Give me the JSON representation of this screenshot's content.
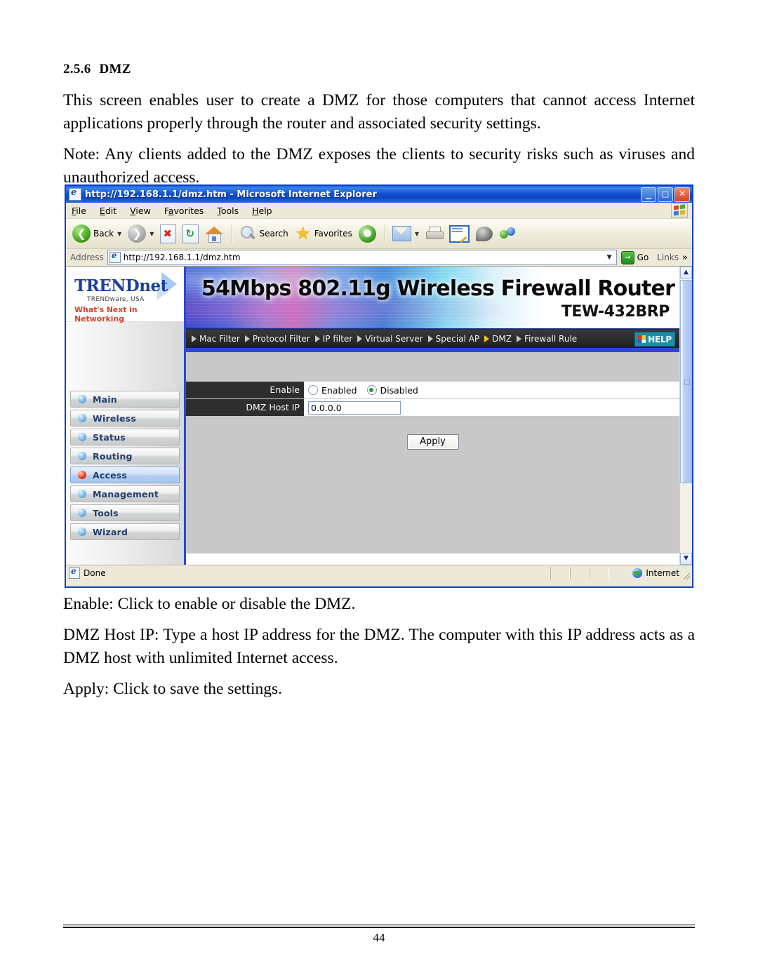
{
  "document": {
    "section_number": "2.5.6",
    "section_title": "DMZ",
    "paragraphs": [
      "This screen enables user to create a DMZ for those computers that cannot access Internet applications properly through the router and associated security settings.",
      "Note: Any clients added to the DMZ exposes the clients to security risks such as viruses and unauthorized access."
    ],
    "descriptions": [
      "Enable: Click to enable or disable the DMZ.",
      "DMZ Host IP: Type a host IP address for the DMZ. The computer with this IP address acts as a DMZ host with unlimited Internet access.",
      "Apply: Click to save the settings."
    ],
    "page_number": "44"
  },
  "browser": {
    "title": "http://192.168.1.1/dmz.htm - Microsoft Internet Explorer",
    "window_controls": {
      "minimize": "_",
      "maximize": "□",
      "close": "✕"
    },
    "menu": [
      "File",
      "Edit",
      "View",
      "Favorites",
      "Tools",
      "Help"
    ],
    "toolbar": {
      "back_label": "Back",
      "forward_label": "",
      "stop_label": "",
      "refresh_label": "",
      "home_label": "",
      "search_label": "Search",
      "favorites_label": "Favorites",
      "media_label": "",
      "mail_label": "",
      "print_label": "",
      "edit_label": "",
      "discuss_label": "",
      "messenger_label": ""
    },
    "address": {
      "label": "Address",
      "value": "http://192.168.1.1/dmz.htm",
      "go_label": "Go",
      "links_label": "Links",
      "chevron": "»",
      "dropdown_arrow": "✕"
    },
    "status": {
      "text": "Done",
      "zone": "Internet"
    },
    "scrollbar": {
      "up_arrow": "▲",
      "down_arrow": "▼"
    }
  },
  "router": {
    "brand": {
      "name": "TRENDnet",
      "subtitle": "TRENDware, USA",
      "tagline": "What's Next in Networking"
    },
    "banner": {
      "title": "54Mbps 802.11g Wireless Firewall Router",
      "model": "TEW-432BRP"
    },
    "tabs": [
      {
        "label": "Mac Filter",
        "active": false
      },
      {
        "label": "Protocol Filter",
        "active": false
      },
      {
        "label": "IP filter",
        "active": false
      },
      {
        "label": "Virtual Server",
        "active": false
      },
      {
        "label": "Special AP",
        "active": false
      },
      {
        "label": "DMZ",
        "active": true
      },
      {
        "label": "Firewall Rule",
        "active": false
      }
    ],
    "help_button": "HELP",
    "sidebar": [
      {
        "label": "Main",
        "active": false
      },
      {
        "label": "Wireless",
        "active": false
      },
      {
        "label": "Status",
        "active": false
      },
      {
        "label": "Routing",
        "active": false
      },
      {
        "label": "Access",
        "active": true
      },
      {
        "label": "Management",
        "active": false
      },
      {
        "label": "Tools",
        "active": false
      },
      {
        "label": "Wizard",
        "active": false
      }
    ],
    "form": {
      "enable_label": "Enable",
      "enabled_option": "Enabled",
      "disabled_option": "Disabled",
      "selected_option": "Disabled",
      "host_ip_label": "DMZ Host IP",
      "host_ip_value": "0.0.0.0",
      "apply_label": "Apply"
    }
  },
  "colors": {
    "title_bar_blue": "#1452d0",
    "sidebar_border_blue": "#2a48d0",
    "label_dark": "#2e2e2e",
    "form_bg": "#c8c8c8",
    "brand_blue": "#1a3f9e",
    "tagline_red": "#d4442a",
    "active_dot_red": "#ee3a22",
    "radio_green": "#1d9e2e",
    "help_teal": "#1a8fa8"
  }
}
